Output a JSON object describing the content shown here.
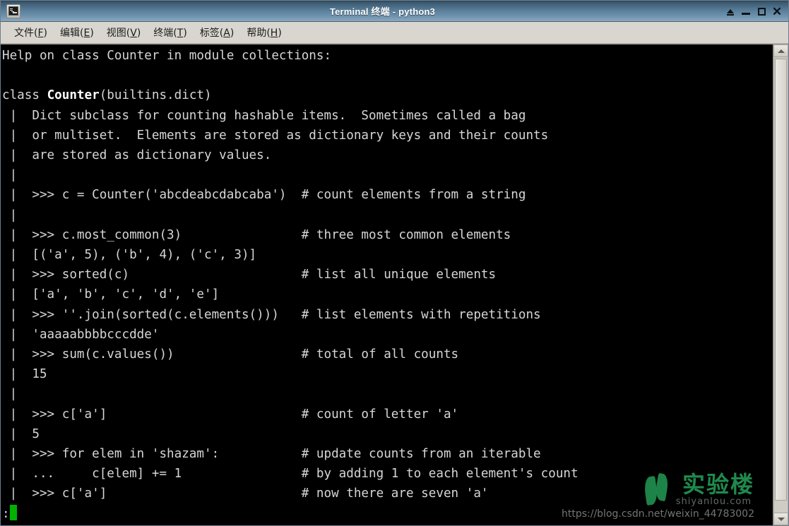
{
  "window": {
    "title": "Terminal 终端 - python3",
    "app_icon": "terminal-icon",
    "controls": [
      {
        "name": "shade-button",
        "label": "⌃"
      },
      {
        "name": "minimize-button",
        "label": "_"
      },
      {
        "name": "maximize-button",
        "label": "□"
      },
      {
        "name": "close-button",
        "label": "✕"
      }
    ]
  },
  "menubar": {
    "items": [
      {
        "label": "文件",
        "accel": "F"
      },
      {
        "label": "编辑",
        "accel": "E"
      },
      {
        "label": "视图",
        "accel": "V"
      },
      {
        "label": "终端",
        "accel": "T"
      },
      {
        "label": "标签",
        "accel": "A"
      },
      {
        "label": "帮助",
        "accel": "H"
      }
    ]
  },
  "terminal": {
    "background": "#000000",
    "foreground": "#d6d6d6",
    "cursor_color": "#00b300",
    "prompt": ":",
    "lines": [
      "Help on class Counter in module collections:",
      "",
      "class \u0001Counter\u0002(builtins.dict)",
      " |  Dict subclass for counting hashable items.  Sometimes called a bag",
      " |  or multiset.  Elements are stored as dictionary keys and their counts",
      " |  are stored as dictionary values.",
      " |",
      " |  >>> c = Counter('abcdeabcdabcaba')  # count elements from a string",
      " |",
      " |  >>> c.most_common(3)                # three most common elements",
      " |  [('a', 5), ('b', 4), ('c', 3)]",
      " |  >>> sorted(c)                       # list all unique elements",
      " |  ['a', 'b', 'c', 'd', 'e']",
      " |  >>> ''.join(sorted(c.elements()))   # list elements with repetitions",
      " |  'aaaaabbbbcccdde'",
      " |  >>> sum(c.values())                 # total of all counts",
      " |  15",
      " |",
      " |  >>> c['a']                          # count of letter 'a'",
      " |  5",
      " |  >>> for elem in 'shazam':           # update counts from an iterable",
      " |  ...     c[elem] += 1                # by adding 1 to each element's count",
      " |  >>> c['a']                          # now there are seven 'a'"
    ]
  },
  "scrollbar": {
    "up_arrow": "scroll-up-arrow",
    "down_arrow": "scroll-down-arrow",
    "thumb_position": "top"
  },
  "watermark": {
    "brand_cn": "实验楼",
    "brand_en": "shiyanlou.com",
    "url": "https://blog.csdn.net/weixin_44783002",
    "color": "#1f8a4c"
  }
}
